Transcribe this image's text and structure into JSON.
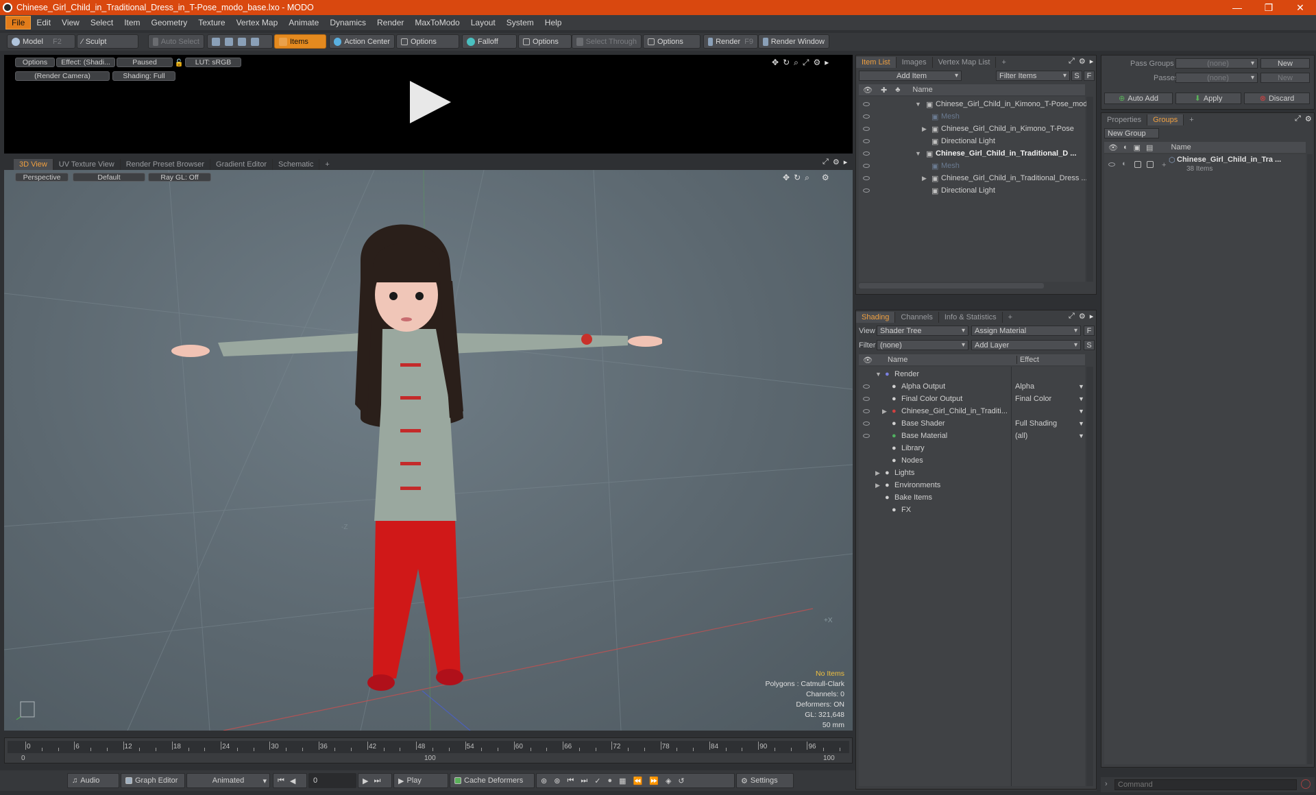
{
  "window": {
    "title": "Chinese_Girl_Child_in_Traditional_Dress_in_T-Pose_modo_base.lxo - MODO",
    "min": "—",
    "max": "❐",
    "close": "✕"
  },
  "menu": [
    "File",
    "Edit",
    "View",
    "Select",
    "Item",
    "Geometry",
    "Texture",
    "Vertex Map",
    "Animate",
    "Dynamics",
    "Render",
    "MaxToModo",
    "Layout",
    "System",
    "Help"
  ],
  "toolbar": {
    "model": "Model",
    "model_key": "F2",
    "sculpt": "Sculpt",
    "auto_select": "Auto Select",
    "items": "Items",
    "action_center": "Action Center",
    "options1": "Options",
    "falloff": "Falloff",
    "options2": "Options",
    "select_through": "Select Through",
    "options3": "Options",
    "render": "Render",
    "render_key": "F9",
    "render_window": "Render Window"
  },
  "preview": {
    "options": "Options",
    "effect": "Effect: (Shadi...",
    "paused": "Paused",
    "lut": "LUT: sRGB",
    "camera": "(Render Camera)",
    "shading": "Shading: Full"
  },
  "viewport_tabs": [
    "3D View",
    "UV Texture View",
    "Render Preset Browser",
    "Gradient Editor",
    "Schematic",
    "+"
  ],
  "viewport": {
    "perspective": "Perspective",
    "default": "Default",
    "raygl": "Ray GL: Off",
    "axis_z": "-Z",
    "axis_x": "+X",
    "info": {
      "no_items": "No Items",
      "polygons": "Polygons : Catmull-Clark",
      "channels": "Channels: 0",
      "deformers": "Deformers: ON",
      "gl": "GL: 321,648",
      "lens": "50 mm"
    }
  },
  "timeline": {
    "ticks": [
      "0",
      "6",
      "12",
      "18",
      "24",
      "30",
      "36",
      "42",
      "48",
      "54",
      "60",
      "66",
      "72",
      "78",
      "84",
      "90",
      "96"
    ],
    "start": "0",
    "mid": "100",
    "end": "100"
  },
  "bottombar": {
    "audio": "Audio",
    "graph_editor": "Graph Editor",
    "animated": "Animated",
    "frame": "0",
    "play": "Play",
    "cache_deformers": "Cache Deformers",
    "settings": "Settings"
  },
  "item_list": {
    "tabs": [
      "Item List",
      "Images",
      "Vertex Map List",
      "+"
    ],
    "add_item": "Add Item",
    "filter_items": "Filter Items",
    "s": "S",
    "f": "F",
    "col_name": "Name",
    "rows": [
      {
        "label": "Chinese_Girl_Child_in_Kimono_T-Pose_mod...",
        "indent": 0,
        "bold": false,
        "dim": false,
        "arrow": "▼"
      },
      {
        "label": "Mesh",
        "indent": 1,
        "bold": false,
        "dim": true,
        "arrow": ""
      },
      {
        "label": "Chinese_Girl_Child_in_Kimono_T-Pose",
        "indent": 1,
        "bold": false,
        "dim": false,
        "arrow": "▶"
      },
      {
        "label": "Directional Light",
        "indent": 1,
        "bold": false,
        "dim": false,
        "arrow": ""
      },
      {
        "label": "Chinese_Girl_Child_in_Traditional_D ...",
        "indent": 0,
        "bold": true,
        "dim": false,
        "arrow": "▼"
      },
      {
        "label": "Mesh",
        "indent": 1,
        "bold": false,
        "dim": true,
        "arrow": ""
      },
      {
        "label": "Chinese_Girl_Child_in_Traditional_Dress ...",
        "indent": 1,
        "bold": false,
        "dim": false,
        "arrow": "▶"
      },
      {
        "label": "Directional Light",
        "indent": 1,
        "bold": false,
        "dim": false,
        "arrow": ""
      }
    ]
  },
  "shading": {
    "tabs": [
      "Shading",
      "Channels",
      "Info & Statistics",
      "+"
    ],
    "view_label": "View",
    "view_value": "Shader Tree",
    "assign_material": "Assign Material",
    "f": "F",
    "filter_label": "Filter",
    "filter_value": "(none)",
    "add_layer": "Add Layer",
    "s": "S",
    "col_name": "Name",
    "col_effect": "Effect",
    "rows": [
      {
        "label": "Render",
        "effect": "",
        "indent": 0,
        "arrow": "▼",
        "eye": false
      },
      {
        "label": "Alpha Output",
        "effect": "Alpha",
        "indent": 1,
        "arrow": "",
        "eye": true
      },
      {
        "label": "Final Color Output",
        "effect": "Final Color",
        "indent": 1,
        "arrow": "",
        "eye": true
      },
      {
        "label": "Chinese_Girl_Child_in_Traditi...",
        "effect": "",
        "indent": 1,
        "arrow": "▶",
        "eye": true
      },
      {
        "label": "Base Shader",
        "effect": "Full Shading",
        "indent": 1,
        "arrow": "",
        "eye": true
      },
      {
        "label": "Base Material",
        "effect": "(all)",
        "indent": 1,
        "arrow": "",
        "eye": true
      },
      {
        "label": "Library",
        "effect": "",
        "indent": 1,
        "arrow": "",
        "eye": false
      },
      {
        "label": "Nodes",
        "effect": "",
        "indent": 1,
        "arrow": "",
        "eye": false
      },
      {
        "label": "Lights",
        "effect": "",
        "indent": 0,
        "arrow": "▶",
        "eye": false
      },
      {
        "label": "Environments",
        "effect": "",
        "indent": 0,
        "arrow": "▶",
        "eye": false
      },
      {
        "label": "Bake Items",
        "effect": "",
        "indent": 0,
        "arrow": "",
        "eye": false
      },
      {
        "label": "FX",
        "effect": "",
        "indent": 1,
        "arrow": "",
        "eye": false
      }
    ]
  },
  "passes": {
    "pass_groups": "Pass Groups",
    "pass_groups_value": "(none)",
    "new": "New",
    "passes": "Passes",
    "passes_value": "(none)",
    "new2": "New",
    "auto_add": "Auto Add",
    "apply": "Apply",
    "discard": "Discard"
  },
  "groups": {
    "tabs": [
      "Properties",
      "Groups",
      "+"
    ],
    "new_group": "New Group",
    "col_name": "Name",
    "item_name": "Chinese_Girl_Child_in_Tra ...",
    "item_count": "38 Items"
  },
  "command": {
    "placeholder": "Command"
  }
}
